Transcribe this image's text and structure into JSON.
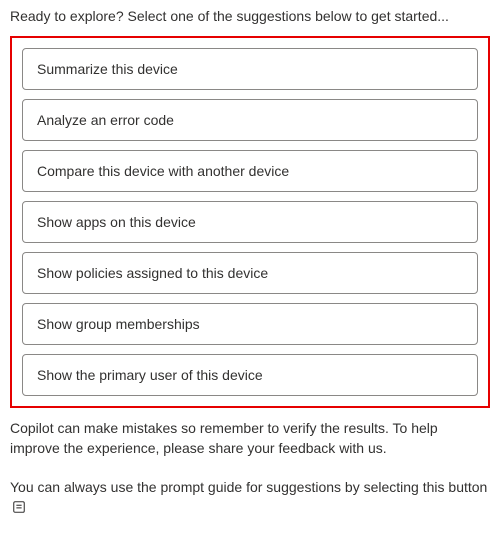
{
  "intro": "Ready to explore? Select one of the suggestions below to get started...",
  "suggestions": [
    {
      "label": "Summarize this device"
    },
    {
      "label": "Analyze an error code"
    },
    {
      "label": "Compare this device with another device"
    },
    {
      "label": "Show apps on this device"
    },
    {
      "label": "Show policies assigned to this device"
    },
    {
      "label": "Show group memberships"
    },
    {
      "label": "Show the primary user of this device"
    }
  ],
  "disclaimer": "Copilot can make mistakes so remember to verify the results. To help improve the experience, please share your feedback with us.",
  "prompt_guide_text": "You can always use the prompt guide for suggestions by selecting this button",
  "icons": {
    "prompt_guide": "prompt-guide-icon"
  }
}
